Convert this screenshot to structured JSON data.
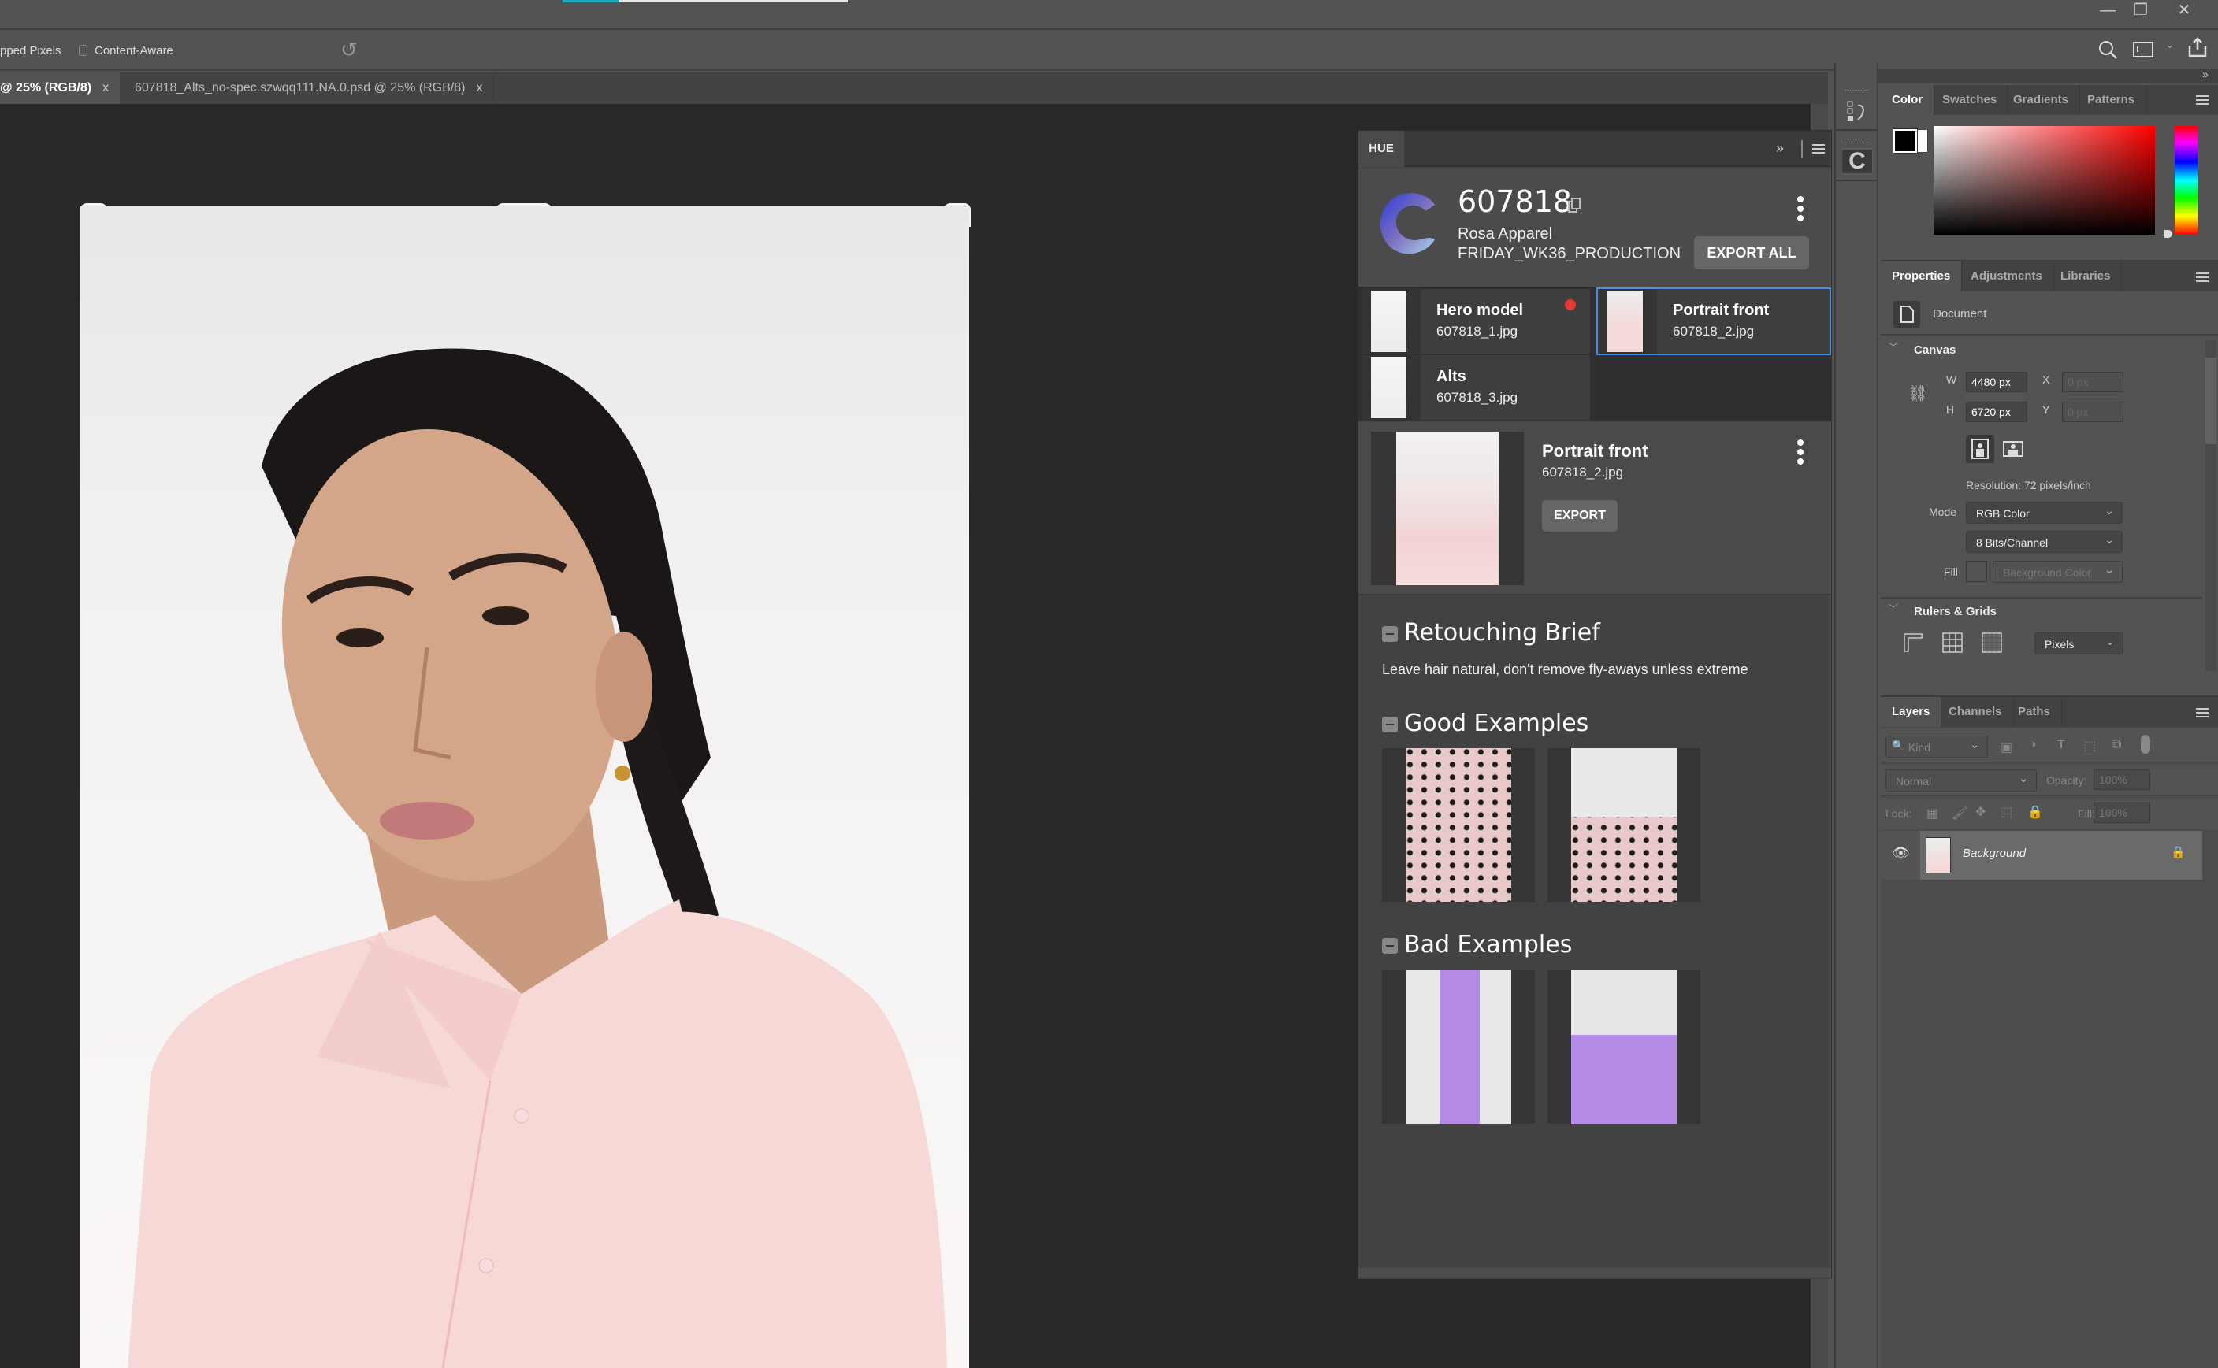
{
  "app": {
    "progress_percent": 20,
    "window_controls": {
      "minimize": "—",
      "restore": "❐",
      "close": "✕"
    }
  },
  "options_bar": {
    "cropped_pixels_label": "pped Pixels",
    "content_aware_label": "Content-Aware",
    "content_aware_checked": false,
    "reset_icon": "↺"
  },
  "document_tabs": [
    {
      "label": "@ 25% (RGB/8)",
      "close": "x",
      "active": true
    },
    {
      "label": "607818_Alts_no-spec.szwqq111.NA.0.psd @ 25% (RGB/8)",
      "close": "x",
      "active": false
    }
  ],
  "hue_panel": {
    "tab_label": "HUE",
    "expand_icon": "»",
    "job_id": "607818",
    "client": "Rosa Apparel",
    "batch": "FRIDAY_WK36_PRODUCTION",
    "export_all_label": "EXPORT ALL",
    "shots": [
      {
        "title": "Hero model",
        "file": "607818_1.jpg",
        "has_alert": true,
        "selected": false
      },
      {
        "title": "Portrait front",
        "file": "607818_2.jpg",
        "has_alert": false,
        "selected": true
      },
      {
        "title": "Alts",
        "file": "607818_3.jpg",
        "has_alert": false,
        "selected": false
      }
    ],
    "detail": {
      "title": "Portrait front",
      "file": "607818_2.jpg",
      "export_label": "EXPORT"
    },
    "sections": {
      "brief_title": "Retouching Brief",
      "brief_text": "Leave hair natural, don't remove fly-aways unless extreme",
      "good_title": "Good Examples",
      "bad_title": "Bad Examples"
    }
  },
  "color_panel": {
    "tabs": [
      "Color",
      "Swatches",
      "Gradients",
      "Patterns"
    ],
    "active_tab": "Color",
    "foreground": "#000000",
    "background": "#ffffff",
    "hue_color": "#ff0000"
  },
  "properties_panel": {
    "tabs": [
      "Properties",
      "Adjustments",
      "Libraries"
    ],
    "active_tab": "Properties",
    "doc_label": "Document",
    "canvas_title": "Canvas",
    "w_label": "W",
    "w_value": "4480 px",
    "h_label": "H",
    "h_value": "6720 px",
    "x_label": "X",
    "x_placeholder": "0 px",
    "y_label": "Y",
    "y_placeholder": "0 px",
    "resolution": "Resolution: 72 pixels/inch",
    "mode_label": "Mode",
    "mode_value": "RGB Color",
    "depth_value": "8 Bits/Channel",
    "fill_label": "Fill",
    "fill_value": "Background Color",
    "rulers_title": "Rulers & Grids",
    "units_value": "Pixels"
  },
  "layers_panel": {
    "tabs": [
      "Layers",
      "Channels",
      "Paths"
    ],
    "active_tab": "Layers",
    "filter_placeholder": "Kind",
    "blend_mode": "Normal",
    "opacity_label": "Opacity:",
    "opacity_value": "100%",
    "lock_label": "Lock:",
    "fill_label": "Fill:",
    "fill_value": "100%",
    "layers": [
      {
        "name": "Background",
        "visible": true,
        "locked": true
      }
    ]
  }
}
